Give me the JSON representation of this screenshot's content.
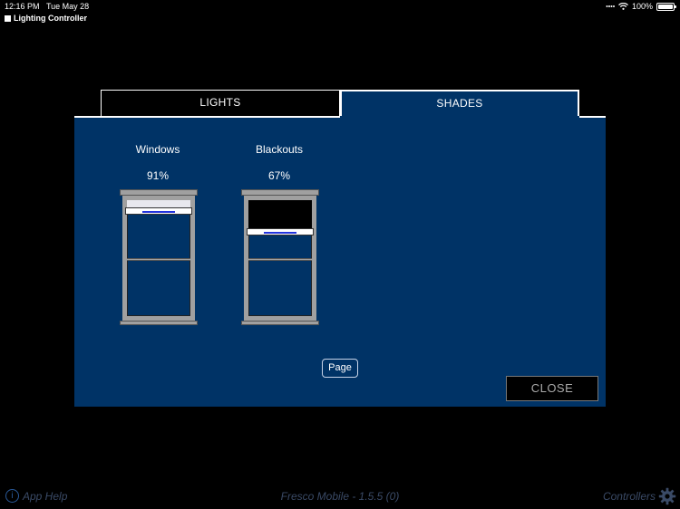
{
  "status_bar": {
    "time": "12:16 PM",
    "date": "Tue May 28",
    "battery": "100%",
    "battery_level": 1.0
  },
  "app": {
    "title": "Lighting Controller"
  },
  "tabs": [
    {
      "label": "LIGHTS",
      "active": false
    },
    {
      "label": "SHADES",
      "active": true
    }
  ],
  "shades": [
    {
      "name": "Windows",
      "percent_label": "91%",
      "open_fraction": 0.91,
      "fabric_color": "#e8e8ee"
    },
    {
      "name": "Blackouts",
      "percent_label": "67%",
      "open_fraction": 0.67,
      "fabric_color": "#000000"
    }
  ],
  "buttons": {
    "page_label": "Page",
    "close_label": "CLOSE"
  },
  "footer": {
    "help_label": "App Help",
    "version": "Fresco Mobile - 1.5.5 (0)",
    "controllers_label": "Controllers"
  },
  "colors": {
    "panel": "#003366",
    "background": "#000000",
    "shade_handle": "#2233dd"
  }
}
